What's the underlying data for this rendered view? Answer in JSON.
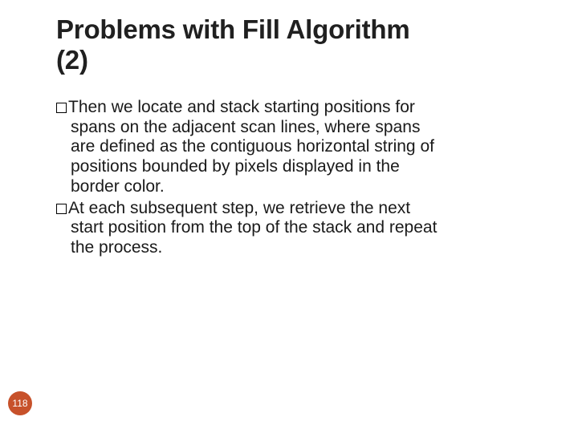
{
  "title_line1": "Problems with Fill Algorithm",
  "title_line2": "(2)",
  "bullets": [
    {
      "first": "Then we locate and stack starting positions for",
      "rest": [
        "spans on the adjacent scan lines, where spans",
        "are defined as the contiguous horizontal string of",
        "positions bounded by pixels displayed in the",
        "border color."
      ]
    },
    {
      "first": "At each subsequent step, we retrieve the next",
      "rest": [
        "start position from the top of the stack and repeat",
        "the process."
      ]
    }
  ],
  "page_number": "118",
  "colors": {
    "badge_bg": "#c7512a",
    "text": "#1a1a1a"
  }
}
